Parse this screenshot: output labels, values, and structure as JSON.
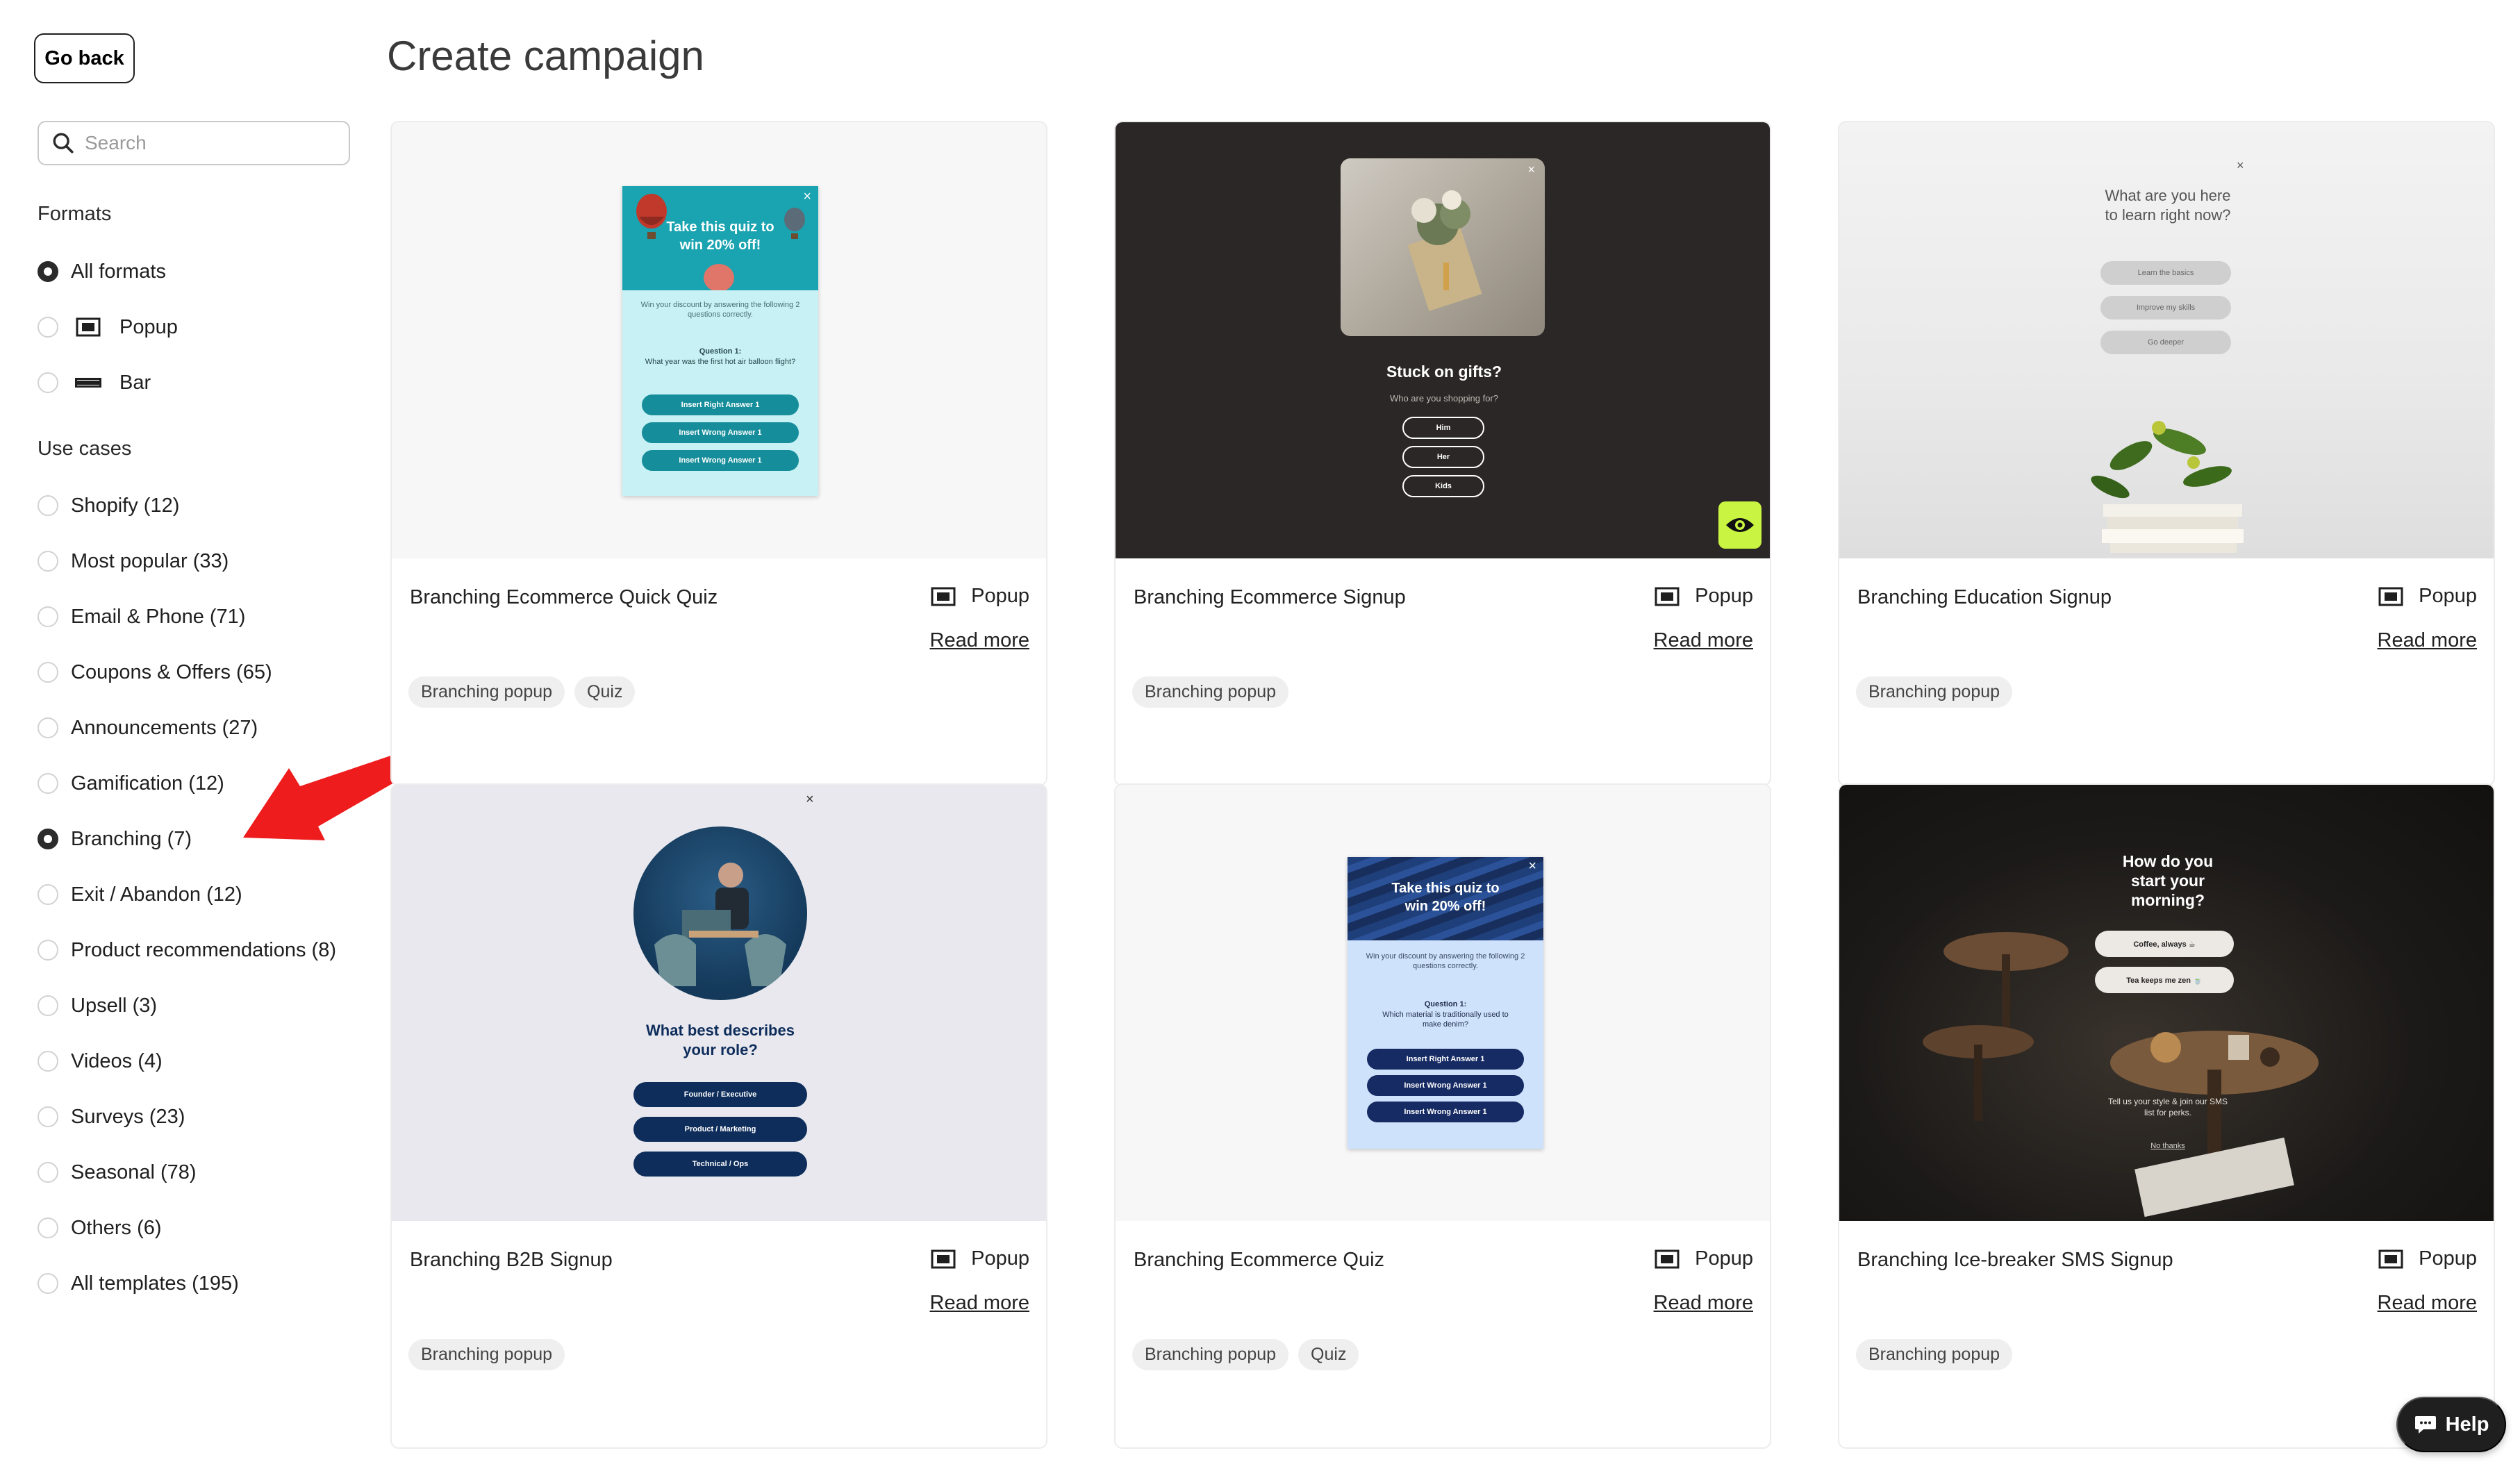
{
  "sidebar": {
    "go_back": "Go back",
    "search_placeholder": "Search",
    "formats_title": "Formats",
    "formats": [
      {
        "label": "All formats",
        "selected": true
      },
      {
        "label": "Popup",
        "selected": false,
        "icon": "popup-icon"
      },
      {
        "label": "Bar",
        "selected": false,
        "icon": "bar-icon"
      }
    ],
    "use_cases_title": "Use cases",
    "use_cases": [
      {
        "label": "Shopify (12)",
        "selected": false
      },
      {
        "label": "Most popular (33)",
        "selected": false
      },
      {
        "label": "Email & Phone (71)",
        "selected": false
      },
      {
        "label": "Coupons & Offers (65)",
        "selected": false
      },
      {
        "label": "Announcements (27)",
        "selected": false
      },
      {
        "label": "Gamification (12)",
        "selected": false
      },
      {
        "label": "Branching (7)",
        "selected": true
      },
      {
        "label": "Exit / Abandon (12)",
        "selected": false
      },
      {
        "label": "Product recommendations (8)",
        "selected": false
      },
      {
        "label": "Upsell (3)",
        "selected": false
      },
      {
        "label": "Videos (4)",
        "selected": false
      },
      {
        "label": "Surveys (23)",
        "selected": false
      },
      {
        "label": "Seasonal (78)",
        "selected": false
      },
      {
        "label": "Others (6)",
        "selected": false
      },
      {
        "label": "All templates (195)",
        "selected": false
      }
    ]
  },
  "main": {
    "title": "Create campaign",
    "read_more": "Read more",
    "cards": [
      {
        "title": "Branching Ecommerce Quick Quiz",
        "format": "Popup",
        "tags": [
          "Branching popup",
          "Quiz"
        ]
      },
      {
        "title": "Branching Ecommerce Signup",
        "format": "Popup",
        "tags": [
          "Branching popup"
        ]
      },
      {
        "title": "Branching Education Signup",
        "format": "Popup",
        "tags": [
          "Branching popup"
        ]
      },
      {
        "title": "Branching B2B Signup",
        "format": "Popup",
        "tags": [
          "Branching popup"
        ]
      },
      {
        "title": "Branching Ecommerce Quiz",
        "format": "Popup",
        "tags": [
          "Branching popup",
          "Quiz"
        ]
      },
      {
        "title": "Branching Ice-breaker SMS Signup",
        "format": "Popup",
        "tags": [
          "Branching popup"
        ]
      }
    ]
  },
  "previews": {
    "quick_quiz": {
      "headline": "Take this quiz to win 20% off!",
      "body": "Win your discount by answering the following 2 questions correctly.",
      "question": "Question 1:",
      "question_text": "What year was the first hot air balloon flight?",
      "answers": [
        "Insert Right Answer 1",
        "Insert Wrong Answer 1",
        "Insert Wrong Answer 1"
      ]
    },
    "ecom_signup": {
      "headline": "Stuck on gifts?",
      "sub": "Who are you shopping for?",
      "answers": [
        "Him",
        "Her",
        "Kids"
      ]
    },
    "education": {
      "headline": "What are you here to learn right now?",
      "answers": [
        "Learn the basics",
        "Improve my skills",
        "Go deeper"
      ]
    },
    "b2b": {
      "headline": "What best describes your role?",
      "answers": [
        "Founder / Executive",
        "Product / Marketing",
        "Technical / Ops"
      ]
    },
    "ecom_quiz": {
      "headline": "Take this quiz to win 20% off!",
      "body": "Win your discount by answering the following 2 questions correctly.",
      "question": "Question 1:",
      "question_text": "Which material is traditionally used to make denim?",
      "answers": [
        "Insert Right Answer 1",
        "Insert Wrong Answer 1",
        "Insert Wrong Answer 1"
      ]
    },
    "icebreaker": {
      "headline": "How do you start your morning?",
      "answers": [
        "Coffee, always ☕",
        "Tea keeps me zen 🍵"
      ],
      "footer": "Tell us your style & join our SMS list for perks.",
      "link": "No thanks"
    }
  },
  "help": {
    "label": "Help"
  },
  "colors": {
    "teal": "#1aa3b0",
    "navy": "#13305c",
    "dark_panel": "#2b2726",
    "preview_eye_bg": "#c9f542"
  }
}
